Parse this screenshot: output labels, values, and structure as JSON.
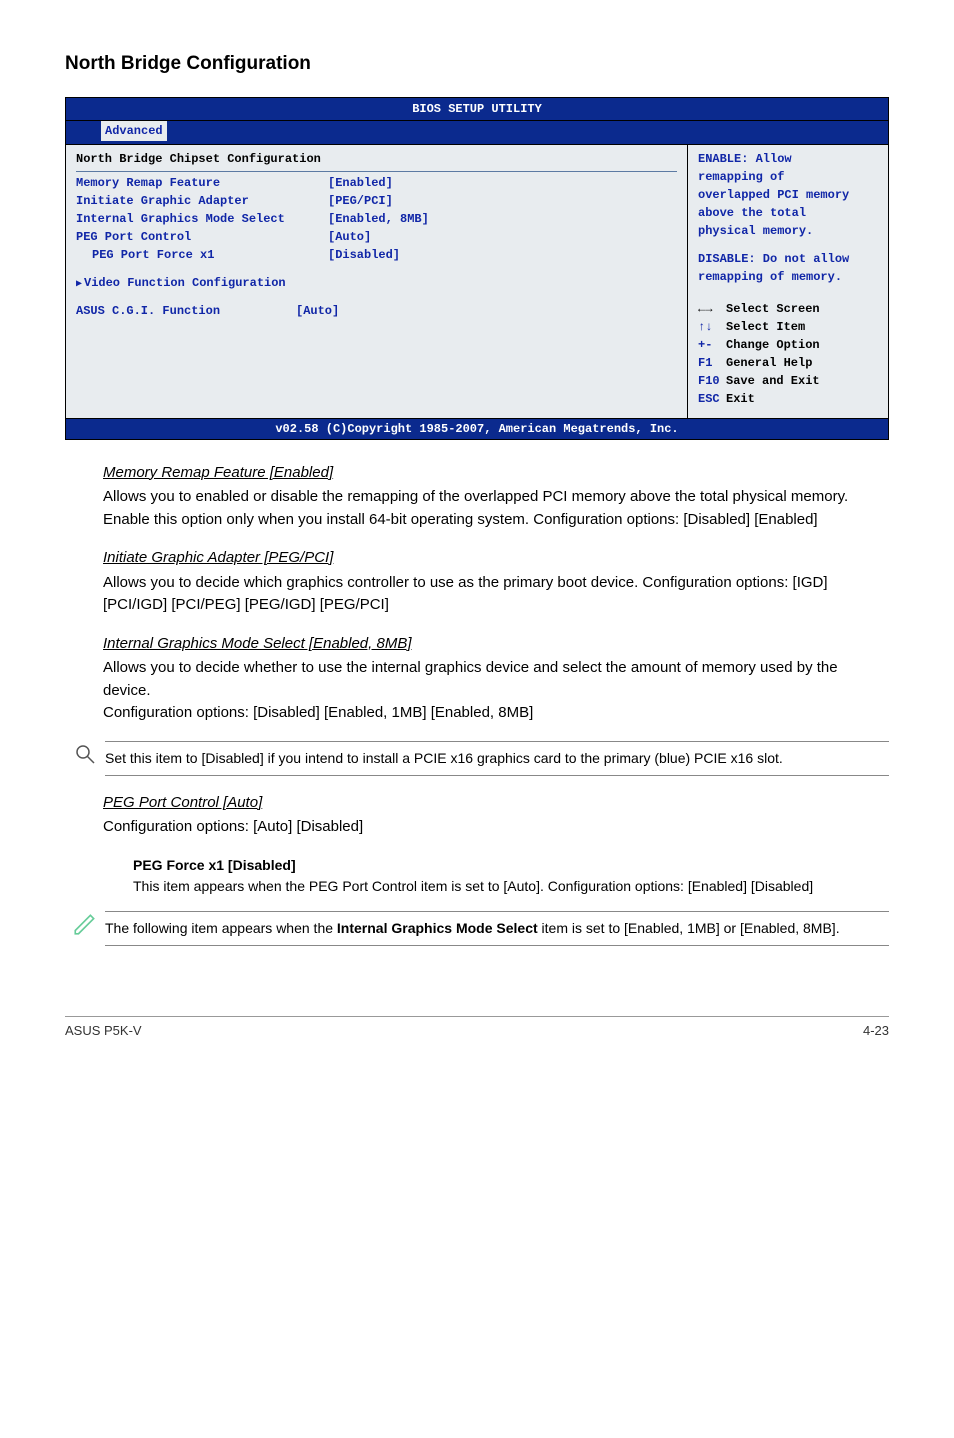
{
  "page": {
    "title": "North Bridge Configuration"
  },
  "bios": {
    "title": "BIOS SETUP UTILITY",
    "tab": "Advanced",
    "section_header": "North Bridge Chipset Configuration",
    "rows": {
      "memory_remap": {
        "label": "Memory Remap Feature",
        "value": "[Enabled]"
      },
      "initiate_graphic": {
        "label": "Initiate Graphic Adapter",
        "value": "[PEG/PCI]"
      },
      "int_graphics_mode": {
        "label": "Internal Graphics Mode Select",
        "value": "[Enabled, 8MB]"
      },
      "peg_port_control": {
        "label": "PEG Port Control",
        "value": "[Auto]"
      },
      "peg_port_force_x1": {
        "label": "PEG Port Force x1",
        "value": "[Disabled]"
      },
      "video_func_conf": {
        "label": "Video Function Configuration"
      },
      "asus_cgi": {
        "label": "ASUS C.G.I. Function",
        "value": "[Auto]"
      }
    },
    "help": {
      "l1": "ENABLE: Allow",
      "l2": "remapping of",
      "l3": "overlapped PCI memory",
      "l4": "above the total",
      "l5": "physical memory.",
      "l6": "DISABLE: Do not allow",
      "l7": "remapping of memory."
    },
    "keys": {
      "select_screen": "Select Screen",
      "select_item": "Select Item",
      "change_option": "Change Option",
      "general_help": "General Help",
      "save_exit": "Save and Exit",
      "exit": "Exit",
      "k_updown": "↑↓",
      "k_pm": "+-",
      "k_f1": "F1",
      "k_f10": "F10",
      "k_esc": "ESC"
    },
    "footer": "v02.58 (C)Copyright 1985-2007, American Megatrends, Inc."
  },
  "sections": {
    "memory_remap": {
      "head": "Memory Remap Feature [Enabled]",
      "body": "Allows you to enabled or disable the remapping of the overlapped PCI memory above the total physical memory. Enable this option only when you install 64-bit operating system. Configuration options: [Disabled] [Enabled]"
    },
    "initiate_graphic": {
      "head": "Initiate Graphic Adapter [PEG/PCI]",
      "body": "Allows you to decide which graphics controller to use as the primary boot device. Configuration options: [IGD] [PCI/IGD] [PCI/PEG] [PEG/IGD] [PEG/PCI]"
    },
    "internal_graphics": {
      "head": "Internal Graphics Mode Select [Enabled, 8MB]",
      "body1": "Allows you to decide whether to use the internal graphics device and select the amount of memory used by the device.",
      "body2": "Configuration options: [Disabled] [Enabled, 1MB] [Enabled, 8MB]"
    },
    "note1": "Set this item to [Disabled] if you intend to install a PCIE x16 graphics card to the primary (blue) PCIE x16 slot.",
    "peg_port_control": {
      "head": "PEG Port Control [Auto]",
      "body": "Configuration options: [Auto] [Disabled]"
    },
    "peg_force_x1": {
      "head": "PEG Force x1 [Disabled]",
      "body": "This item appears when the PEG Port Control item is set to [Auto]. Configuration options: [Enabled] [Disabled]"
    },
    "note2_pre": "The following item appears when the ",
    "note2_bold": "Internal Graphics Mode Select",
    "note2_post": " item is set to [Enabled, 1MB] or [Enabled, 8MB]."
  },
  "footer": {
    "left": "ASUS P5K-V",
    "right": "4-23"
  }
}
